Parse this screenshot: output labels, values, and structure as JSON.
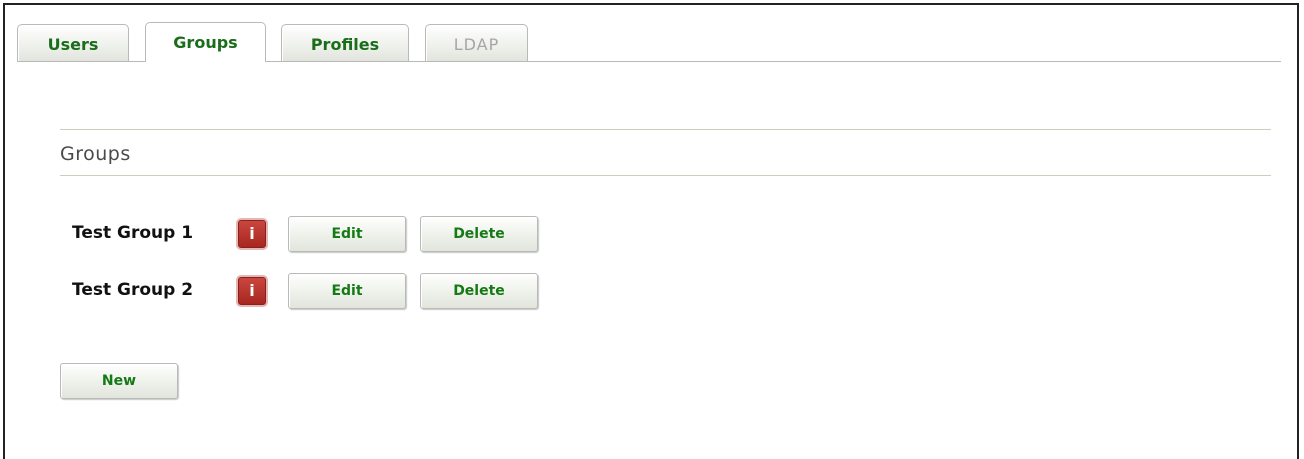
{
  "tabs": [
    {
      "label": "Users",
      "state": "normal"
    },
    {
      "label": "Groups",
      "state": "active"
    },
    {
      "label": "Profiles",
      "state": "normal"
    },
    {
      "label": "LDAP",
      "state": "disabled"
    }
  ],
  "section": {
    "title": "Groups"
  },
  "groups": [
    {
      "name": "Test Group 1",
      "info_icon": "info-icon",
      "edit_label": "Edit",
      "delete_label": "Delete"
    },
    {
      "name": "Test Group 2",
      "info_icon": "info-icon",
      "edit_label": "Edit",
      "delete_label": "Delete"
    }
  ],
  "actions": {
    "new_label": "New"
  },
  "colors": {
    "accent_green": "#157a15",
    "info_red": "#a7261f",
    "disabled_gray": "#a6a6a6"
  }
}
